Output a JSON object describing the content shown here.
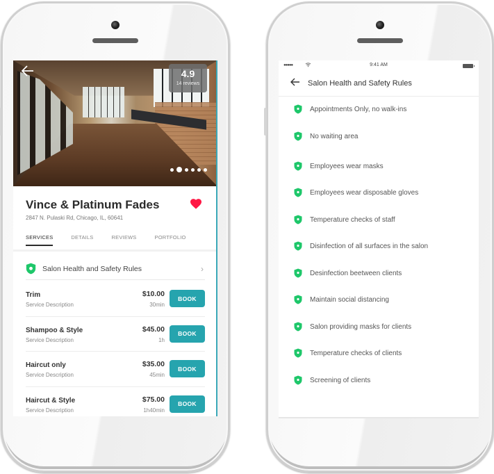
{
  "left_phone": {
    "hero": {
      "back_icon": "arrow-left-icon",
      "rating": "4.9",
      "reviews": "14 reviews",
      "carousel_count": 6,
      "carousel_active_index": 1
    },
    "salon": {
      "name": "Vince & Platinum Fades",
      "address": "2847 N. Pulaski Rd, Chicago, IL, 60641",
      "favorite_icon": "heart-icon",
      "favorite_color": "#ff1744"
    },
    "tabs": [
      {
        "label": "SERVICES",
        "active": true
      },
      {
        "label": "DETAILS",
        "active": false
      },
      {
        "label": "REVIEWS",
        "active": false
      },
      {
        "label": "PORTFOLIO",
        "active": false
      }
    ],
    "safety_link": {
      "label": "Salon Health and Safety Rules",
      "icon": "shield-icon",
      "chevron": "›"
    },
    "services": [
      {
        "name": "Trim",
        "description": "Service Description",
        "price": "$10.00",
        "duration": "30min",
        "button": "BOOK"
      },
      {
        "name": "Shampoo & Style",
        "description": "Service Description",
        "price": "$45.00",
        "duration": "1h",
        "button": "BOOK"
      },
      {
        "name": "Haircut only",
        "description": "Service Description",
        "price": "$35.00",
        "duration": "45min",
        "button": "BOOK"
      },
      {
        "name": "Haircut & Style",
        "description": "Service Description",
        "price": "$75.00",
        "duration": "1h40min",
        "button": "BOOK"
      }
    ]
  },
  "right_phone": {
    "statusbar": {
      "signal": "●●●●●",
      "wifi": "wifi-icon",
      "time": "9:41 AM",
      "battery": "battery-icon"
    },
    "header": {
      "back": "←",
      "title": "Salon Health and Safety Rules"
    },
    "rules": [
      "Appointments Only, no walk-ins",
      "No waiting area",
      "Employees wear masks",
      "Employees wear disposable gloves",
      "Temperature checks of staff",
      "Disinfection of all surfaces in the salon",
      "Desinfection beetween clients",
      "Maintain social distancing",
      "Salon providing masks for clients",
      "Temperature checks of clients",
      "Screening of clients"
    ]
  },
  "colors": {
    "accent": "#26a4ae",
    "shield_green": "#1ec76a",
    "heart_red": "#ff1744"
  }
}
